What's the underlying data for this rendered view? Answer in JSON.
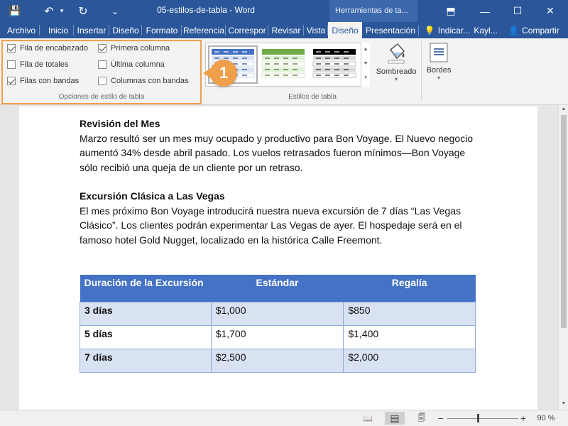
{
  "titlebar": {
    "document_title": "05-estilos-de-tabla  -  Word",
    "contextual_tools_label": "Herramientas de ta...",
    "save_icon": "save-icon",
    "undo_icon": "undo-icon",
    "redo_icon": "redo-icon",
    "customize_icon": "customize-qat-icon",
    "ribbon_display_icon": "ribbon-display-icon",
    "minimize_icon": "minimize-icon",
    "maximize_icon": "maximize-icon",
    "close_icon": "close-icon",
    "glyphs": {
      "save": "💾",
      "undo": "↶",
      "undo_dropdown": "▾",
      "redo": "↻",
      "customize": "⌄",
      "ribbon_display": "⬒",
      "minimize": "—",
      "maximize": "☐",
      "close": "✕"
    }
  },
  "tabs": [
    {
      "label": "Archivo"
    },
    {
      "label": "Inicio"
    },
    {
      "label": "Insertar"
    },
    {
      "label": "Diseño"
    },
    {
      "label": "Formato"
    },
    {
      "label": "Referencia"
    },
    {
      "label": "Correspor"
    },
    {
      "label": "Revisar"
    },
    {
      "label": "Vista"
    },
    {
      "label": "Diseño",
      "active": true
    },
    {
      "label": "Presentación"
    }
  ],
  "tell_me": {
    "label": "Indicar...",
    "icon": "lightbulb-icon",
    "glyph": "💡"
  },
  "user": {
    "name": "Kayl..."
  },
  "share": {
    "label": "Compartir",
    "icon": "share-person-icon",
    "glyph": "👤"
  },
  "ribbon": {
    "style_options_group": {
      "label": "Opciones de estilo de tabla",
      "options": [
        {
          "label": "Fila de encabezado",
          "checked": true
        },
        {
          "label": "Primera columna",
          "checked": true
        },
        {
          "label": "Fila de totales",
          "checked": false
        },
        {
          "label": "Última columna",
          "checked": false
        },
        {
          "label": "Filas con bandas",
          "checked": true
        },
        {
          "label": "Columnas con bandas",
          "checked": false
        }
      ]
    },
    "table_styles_group": {
      "label": "Estilos de tabla",
      "swatch_colors": [
        "#4472c4",
        "#70ad47",
        "#000000"
      ]
    },
    "shading": {
      "label": "Sombreado",
      "icon": "paint-bucket-icon"
    },
    "borders": {
      "label": "Bordes",
      "icon": "borders-icon"
    },
    "callout_number": "1"
  },
  "document": {
    "section1_heading": "Revisión del Mes",
    "section1_body": "Marzo resultó ser un mes muy ocupado y productivo para Bon Voyage. El Nuevo negocio aumentó 34% desde abril pasado. Los vuelos retrasados fueron mínimos—Bon Voyage sólo recibió una queja de un cliente por un retraso.",
    "section2_heading": "Excursión Clásica a Las Vegas",
    "section2_body": "El mes próximo Bon Voyage introducirá nuestra nueva excursión de 7 días “Las Vegas Clásico”. Los clientes podrán experimentar Las Vegas de ayer. El hospedaje será en el famoso hotel Gold Nugget, localizado en la histórica Calle Freemont.",
    "table": {
      "headers": [
        "Duración de la Excursión",
        "Estándar",
        "Regalía"
      ],
      "rows": [
        [
          "3 días",
          "$1,000",
          "$850"
        ],
        [
          "5 días",
          "$1,700",
          "$1,400"
        ],
        [
          "7 días",
          "$2,500",
          "$2,000"
        ]
      ]
    }
  },
  "statusbar": {
    "zoom_label": "90 %",
    "read_mode_icon": "read-mode-icon",
    "print_layout_icon": "print-layout-icon",
    "web_layout_icon": "web-layout-icon",
    "zoom_out_label": "−",
    "zoom_in_label": "+",
    "glyphs": {
      "read_mode": "📖",
      "print_layout": "▤",
      "web_layout": "🗐"
    }
  }
}
